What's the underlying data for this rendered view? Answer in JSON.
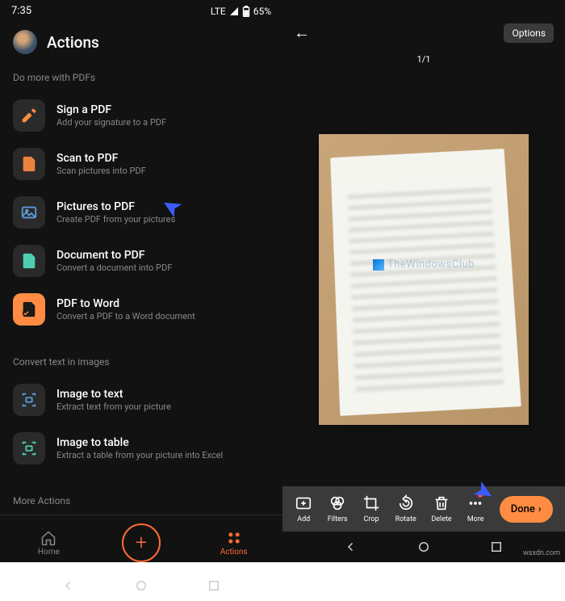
{
  "left": {
    "status": {
      "time": "7:35",
      "network": "LTE",
      "battery": "65%"
    },
    "title": "Actions",
    "sections": {
      "s1": "Do more with PDFs",
      "s2": "Convert text in images",
      "s3": "More Actions"
    },
    "actions": [
      {
        "title": "Sign a PDF",
        "subtitle": "Add your signature to a PDF"
      },
      {
        "title": "Scan to PDF",
        "subtitle": "Scan pictures into PDF"
      },
      {
        "title": "Pictures to PDF",
        "subtitle": "Create PDF from your pictures"
      },
      {
        "title": "Document to PDF",
        "subtitle": "Convert a document into PDF"
      },
      {
        "title": "PDF to Word",
        "subtitle": "Convert a PDF to a Word document"
      },
      {
        "title": "Image to text",
        "subtitle": "Extract text from your picture"
      },
      {
        "title": "Image to table",
        "subtitle": "Extract a table from your picture into Excel"
      }
    ],
    "nav": {
      "home": "Home",
      "actions": "Actions"
    }
  },
  "right": {
    "options": "Options",
    "counter": "1/1",
    "toolbar": {
      "add": "Add",
      "filters": "Filters",
      "crop": "Crop",
      "rotate": "Rotate",
      "delete": "Delete",
      "more": "More",
      "done": "Done"
    }
  },
  "watermark": "TheWindowsClub",
  "credit": "wsxdn.com"
}
